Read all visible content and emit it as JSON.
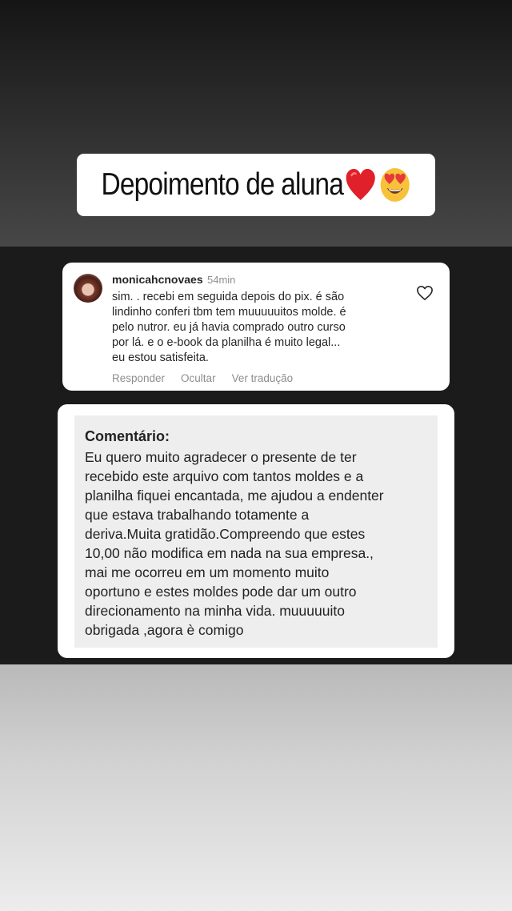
{
  "story": {
    "title": "Depoimento de aluna"
  },
  "comment": {
    "username": "monicahcnovaes",
    "time": "54min",
    "text": "sim. . recebi  em seguida depois do pix. é são\nlindinho  conferi tbm tem muuuuuitos molde. é\npelo nutror. eu já havia comprado  outro curso\npor lá.  e o e-book da planilha é muito legal...\neu estou satisfeita.",
    "actions": {
      "reply": "Responder",
      "hide": "Ocultar",
      "translate": "Ver tradução"
    },
    "icons": {
      "like": "heart-outline-icon"
    }
  },
  "feedback": {
    "heading": "Comentário:",
    "body": "Eu quero muito agradecer o presente de ter\nrecebido este arquivo com tantos moldes e a\nplanilha fiquei encantada, me ajudou a endenter\nque estava trabalhando totamente a\nderiva.Muita gratidão.Compreendo que estes\n10,00 não modifica em nada na sua empresa.,\nmai me ocorreu em um momento muito\noportuno e estes moldes pode dar um outro\ndirecionamento na minha vida. muuuuuito\nobrigada ,agora è comigo"
  },
  "colors": {
    "accent_heart": "#e0202a",
    "emoji_face": "#f7c23a"
  }
}
